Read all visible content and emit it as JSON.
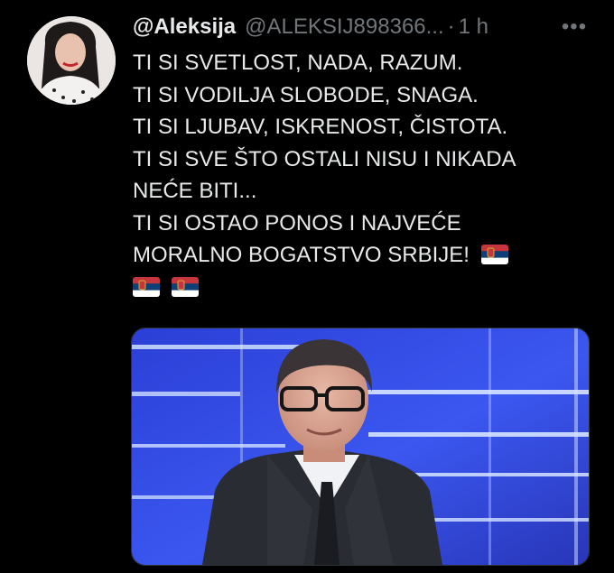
{
  "tweet": {
    "display_name": "@Aleksija",
    "handle": "@ALEKSIJ898366...",
    "separator": "·",
    "time": "1 h",
    "more_icon": "more-dots-icon",
    "lines": [
      "TI SI SVETLOST, NADA, RAZUM.",
      "TI SI VODILJA SLOBODE, SNAGA.",
      "TI SI LJUBAV, ISKRENOST, ČISTOTA.",
      "TI SI SVE ŠTO OSTALI NISU I NIKADA",
      "NEĆE BITI...",
      "TI SI OSTAO PONOS I NAJVEĆE",
      "MORALNO BOGATSTVO SRBIJE!"
    ],
    "flag_icon": "serbian-flag-emoji"
  },
  "colors": {
    "background": "#000000",
    "text": "#e7e9ea",
    "secondary": "#71767b",
    "flag_red": "#c6363c",
    "flag_blue": "#0c4076",
    "flag_white": "#ffffff"
  }
}
